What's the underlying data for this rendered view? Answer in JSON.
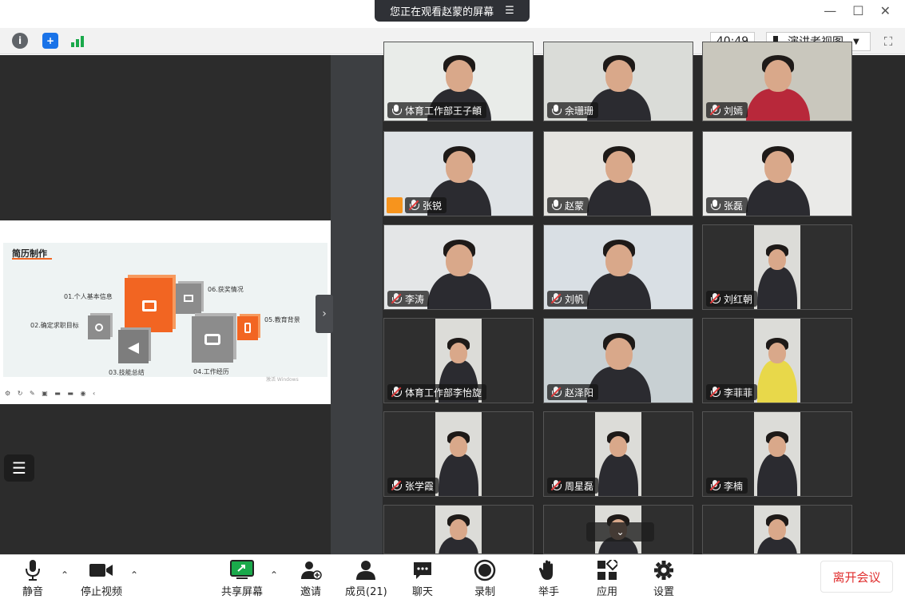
{
  "banner": {
    "text": "您正在观看赵蒙的屏幕",
    "menu_icon": "menu-icon"
  },
  "window": {
    "minimize": "—",
    "maximize": "☐",
    "close": "✕"
  },
  "topbar": {
    "timer": "40:49",
    "view_label": "演讲者视图"
  },
  "slide": {
    "title": "简历制作",
    "items": [
      "01.个人基本信息",
      "02.确定求职目标",
      "03.技能总结",
      "04.工作经历",
      "05.教育背景",
      "06.获奖情况"
    ],
    "watermark": "激活 Windows"
  },
  "participants": [
    {
      "name": "体育工作部王子頔",
      "muted": false
    },
    {
      "name": "余珊珊",
      "muted": false
    },
    {
      "name": "刘嫣",
      "muted": true
    },
    {
      "name": "张锐",
      "muted": true,
      "host": true
    },
    {
      "name": "赵蒙",
      "muted": false
    },
    {
      "name": "张磊",
      "muted": false
    },
    {
      "name": "李涛",
      "muted": true
    },
    {
      "name": "刘帆",
      "muted": true
    },
    {
      "name": "刘红朝",
      "muted": true
    },
    {
      "name": "体育工作部李怡旋",
      "muted": true
    },
    {
      "name": "赵泽阳",
      "muted": true
    },
    {
      "name": "李菲菲",
      "muted": true
    },
    {
      "name": "张学霞",
      "muted": true
    },
    {
      "name": "周星磊",
      "muted": true
    },
    {
      "name": "李楠",
      "muted": true
    },
    {
      "name": "",
      "muted": true
    },
    {
      "name": "",
      "muted": true
    },
    {
      "name": "",
      "muted": true
    }
  ],
  "toolbar": {
    "mute": "静音",
    "stop_video": "停止视频",
    "share": "共享屏幕",
    "invite": "邀请",
    "members": "成员(21)",
    "chat": "聊天",
    "record": "录制",
    "raise_hand": "举手",
    "apps": "应用",
    "settings": "设置",
    "leave": "离开会议"
  },
  "colors": {
    "accent": "#f26522",
    "leave": "#e02e2e",
    "share_green": "#1aa94b"
  }
}
